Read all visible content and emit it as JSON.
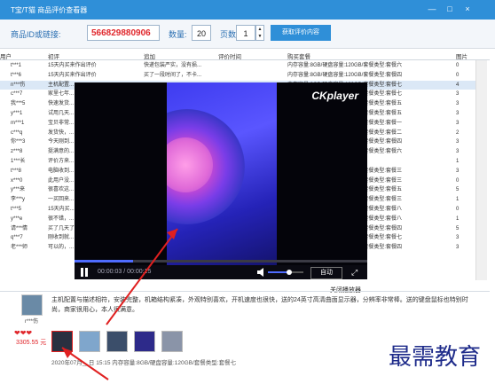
{
  "window": {
    "title": "T宝/T猫 商品评价查看器",
    "controls": [
      "—",
      "□",
      "×"
    ]
  },
  "query": {
    "id_label": "商品ID或链接:",
    "id_value": "566829880906",
    "count_label": "数量:",
    "count_value": "20",
    "page_label": "页数:",
    "page_value": "1",
    "fetch_button": "获取评价内容"
  },
  "table": {
    "headers": [
      "用户",
      "初评",
      "追加",
      "评价时间",
      "购买套餐",
      "图片"
    ],
    "rows": [
      [
        "t***1",
        "15天内买来作出评价",
        "快递包装严实，没有损...",
        "",
        "内存容量:8GB/硬盘容量:120GB/套餐类型:套餐六",
        "0"
      ],
      [
        "t***6",
        "15天内买来作出评价",
        "买了一段时间了，不卡...",
        "",
        "内存容量:8GB/硬盘容量:120GB/套餐类型:套餐四",
        "0"
      ],
      [
        "n***伤",
        "主机配置...",
        "",
        "",
        "内存容量:8GB/硬盘容量:120GB/套餐类型:套餐七",
        "4"
      ],
      [
        "c***7",
        "家里七年...",
        "",
        "",
        "内存容量:8GB/硬盘容量:120GB/套餐类型:套餐七",
        "3"
      ],
      [
        "我***5",
        "快速发货...",
        "",
        "",
        "内存容量:8GB/硬盘容量:120GB/套餐类型:套餐五",
        "3"
      ],
      [
        "y***1",
        "试用几天...",
        "",
        "",
        "内存容量:8GB/硬盘容量:120GB/套餐类型:套餐五",
        "3"
      ],
      [
        "m***1",
        "宝贝非常...",
        "",
        "",
        "内存容量:8GB/硬盘容量:120GB/套餐类型:套餐一",
        "3"
      ],
      [
        "c***q",
        "发货快，...",
        "",
        "",
        "内存容量:8GB/硬盘容量:120GB/套餐类型:套餐二",
        "2"
      ],
      [
        "你***3",
        "今天刚到...",
        "",
        "",
        "内存容量:8GB/硬盘容量:120GB/套餐类型:套餐四",
        "3"
      ],
      [
        "z***8",
        "挺满意的...",
        "",
        "",
        "内存容量:8GB/硬盘容量:120GB/套餐类型:套餐六",
        "3"
      ],
      [
        "1***长",
        "评价方来...",
        "",
        "",
        "",
        "1"
      ],
      [
        "t***8",
        "电脑收到...",
        "",
        "",
        "内存容量:8GB/硬盘容量:120GB/套餐类型:套餐三",
        "3"
      ],
      [
        "x***0",
        "此用户没...",
        "",
        "",
        "内存容量:8GB/硬盘容量:120GB/套餐类型:套餐三",
        "0"
      ],
      [
        "y***来",
        "很喜欢这...",
        "",
        "",
        "内存容量:8GB/硬盘容量:120GB/套餐类型:套餐五",
        "5"
      ],
      [
        "李***y",
        "一买回来...",
        "",
        "",
        "内存容量:8GB/硬盘容量:120GB/套餐类型:套餐三",
        "1"
      ],
      [
        "t***5",
        "15天内买...",
        "",
        "",
        "内存容量:8GB/硬盘容量:120GB/套餐类型:套餐八",
        "0"
      ],
      [
        "y***e",
        "很不错，...",
        "",
        "",
        "内存容量:8GB/硬盘容量:120GB/套餐类型:套餐八",
        "1"
      ],
      [
        "请***情",
        "买了几天了...",
        "",
        "",
        "内存容量:8GB/硬盘容量:120GB/套餐类型:套餐四",
        "5"
      ],
      [
        "q***7",
        "刚收到就...",
        "",
        "",
        "内存容量:8GB/硬盘容量:120GB/套餐类型:套餐七",
        "3"
      ],
      [
        "老***师",
        "可以的，...",
        "",
        "",
        "内存容量:8GB/硬盘容量:120GB/套餐类型:套餐四",
        "3"
      ]
    ]
  },
  "player": {
    "logo": "CKplayer",
    "time": "00:00:03 / 00:00:15",
    "progress": 0.2,
    "volume": 0.6,
    "auto_button": "自动",
    "close_label": "关闭播放器"
  },
  "detail": {
    "username": "r***伤",
    "hearts": "❤❤❤",
    "amount": "3305.55 元",
    "review": "主机配置与描述相符，安装完整，机箱结构紧凑，外观特别喜欢，开机速度也很快，送的24英寸高清曲面显示器，分辨率非常棒。送的键盘鼠标也特别时尚，商家很用心，本人很满意。",
    "meta": "2020年07月__日 15:15 内存容量:8GB/硬盘容量:120GB/套餐类型:套餐七",
    "thumb_colors": [
      "#2a3040",
      "#7fa6cc",
      "#3b4e6a",
      "#2d2a8a",
      "#8a94a8"
    ]
  },
  "watermark": "最需教育"
}
